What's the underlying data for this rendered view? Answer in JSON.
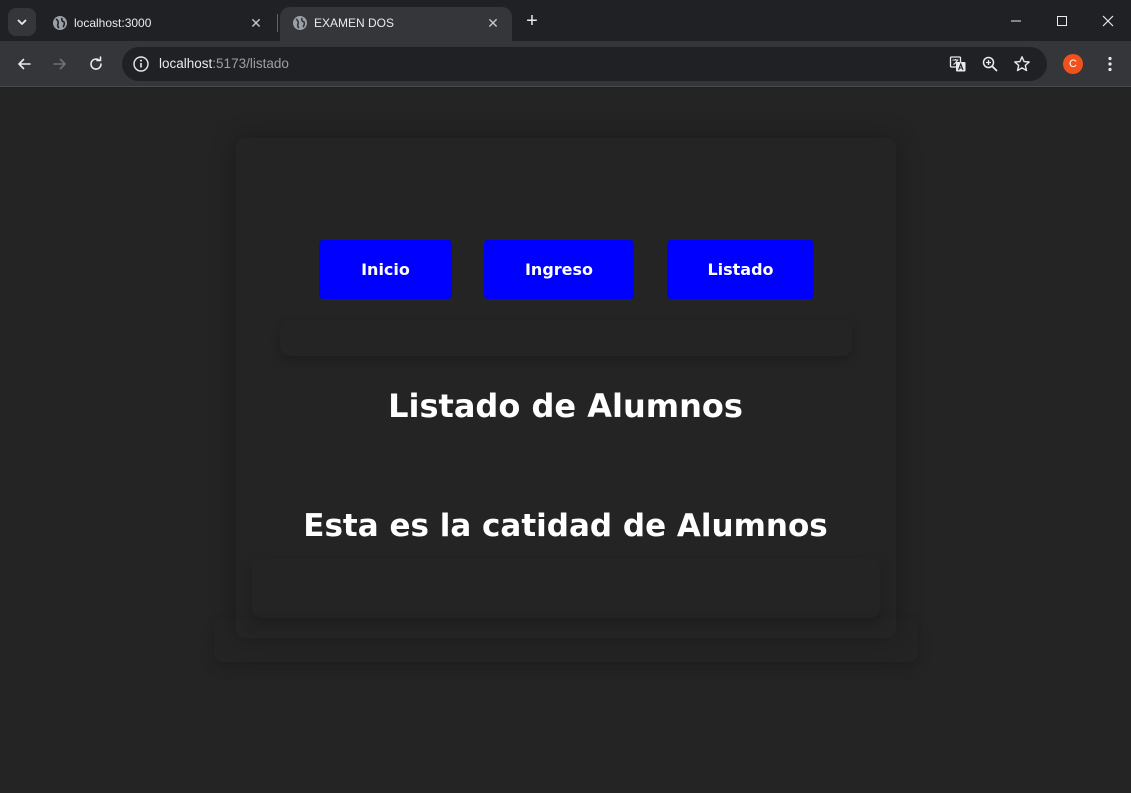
{
  "tabs": [
    {
      "title": "localhost:3000",
      "close": "✕"
    },
    {
      "title": "EXAMEN DOS",
      "close": "✕"
    }
  ],
  "new_tab": "+",
  "address_bar": {
    "host": "localhost",
    "path": ":5173/listado"
  },
  "profile_initial": "C",
  "nav": {
    "inicio": "Inicio",
    "ingreso": "Ingreso",
    "listado": "Listado"
  },
  "page_title": "Listado de Alumnos",
  "count_text": "Esta es la catidad de Alumnos",
  "colors": {
    "button_bg": "#0000ff",
    "page_bg": "#242424",
    "text": "#ffffff"
  }
}
